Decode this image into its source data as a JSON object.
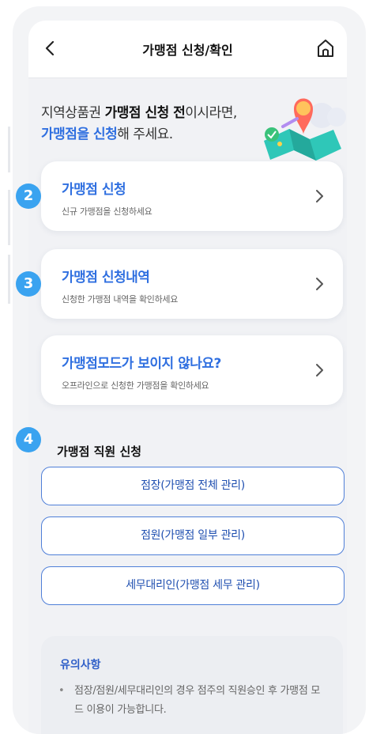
{
  "header": {
    "title": "가맹점 신청/확인"
  },
  "intro": {
    "line1_a": "지역상품권 ",
    "line1_b": "가맹점 신청 전",
    "line1_c": "이시라면,",
    "line2_a": "가맹점을 신청",
    "line2_b": "해 주세요."
  },
  "cards": [
    {
      "title": "가맹점 신청",
      "subtitle": "신규 가맹점을 신청하세요",
      "badge": "2"
    },
    {
      "title": "가맹점 신청내역",
      "subtitle": "신청한 가맹점 내역을 확인하세요",
      "badge": "3"
    },
    {
      "title": "가맹점모드가 보이지 않나요?",
      "subtitle": "오프라인으로 신청한 가맹점을 확인하세요",
      "badge": ""
    }
  ],
  "staff": {
    "badge": "4",
    "title": "가맹점 직원 신청",
    "buttons": [
      "점장(가맹점 전체 관리)",
      "점원(가맹점 일부 관리)",
      "세무대리인(가맹점 세무 관리)"
    ]
  },
  "notice": {
    "title": "유의사항",
    "bullet": "•",
    "text": "점장/점원/세무대리인의 경우 점주의 직원승인 후 가맹점 모드 이용이 가능합니다."
  },
  "colors": {
    "accent": "#2f6fe0",
    "badge": "#3aa3f0",
    "pill_border": "#4f7fd8"
  }
}
